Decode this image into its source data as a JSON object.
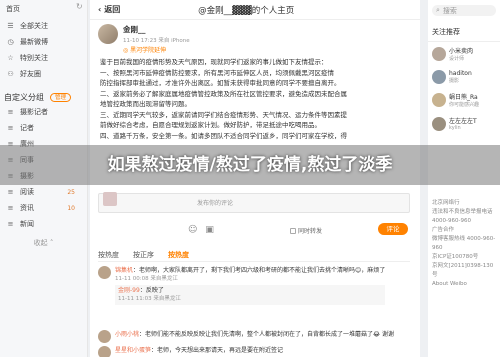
{
  "nav": {
    "home": "首页",
    "items": [
      {
        "icon": "list-icon",
        "label": "全部关注"
      },
      {
        "icon": "clock-icon",
        "label": "最新微博"
      },
      {
        "icon": "star-icon",
        "label": "特别关注"
      },
      {
        "icon": "users-icon",
        "label": "好友圈"
      }
    ],
    "group_title": "自定义分组",
    "manage": "管理",
    "groups": [
      {
        "label": "摄影记者",
        "count": ""
      },
      {
        "label": "记者",
        "count": ""
      },
      {
        "label": "廣州",
        "count": ""
      },
      {
        "label": "同事",
        "count": ""
      },
      {
        "label": "摄影",
        "count": ""
      },
      {
        "label": "阅读",
        "count": "25"
      },
      {
        "label": "资讯",
        "count": "10"
      },
      {
        "label": "新闻",
        "count": ""
      }
    ],
    "collapse": "收起"
  },
  "topbar": {
    "back": "返回",
    "title": "@金刚__▓▓▓的个人主页"
  },
  "post": {
    "author": "金刚__",
    "meta": "11-10 17:23 来自 iPhone",
    "tag": "◎ 黑河学院延伸",
    "lines": [
      "鉴于目前我国的疫情形势及天气原因，现就同学们返家的事儿做如下友情提示：",
      "一、按照黑河市延伸疫情防控要求，所有黑河市延伸区人员，均须佩戴黑河区疫情",
      "防控指挥部审批通过，才准许外出离区。如暂未获得审批同意的同学不要擅自离开。",
      "二、返家前务必了解家庭属地疫情管控政策及所在社区管控要求，避免造成因未配合属",
      "地管控政策而出现滞留等问题。",
      "三、近期同学天气较多，返家前请同学们结合疫情形势、天气情况、运力条件等因素提",
      "前做好综合考虑，自愿合理规划返家计划。做好防护，带足抵途中吃喝用品。",
      "四、道路千万条，安全第一条。如请多团队不适合同学们返乡，同学们可家在学校，得"
    ]
  },
  "banner": {
    "text": "如果熬过疫情/熬过了疫情,熬过了淡季"
  },
  "comment_box": {
    "placeholder": "发布你的评论"
  },
  "publish": {
    "also_forward": "同时转发",
    "submit": "评论"
  },
  "tabs": [
    {
      "label": "按热度",
      "active": false
    },
    {
      "label": "按正序",
      "active": false
    },
    {
      "label": "按热度",
      "active": true
    }
  ],
  "comments": [
    {
      "name": "锦集机",
      "text": "老师啊，大家队都离开了，剩下我们考四六级和考研的都不能让我们去挑个清晰吗😊，麻烦了",
      "time": "11-11 00:08 来自黑龙江",
      "reply_name": "金刚-99",
      "reply_text": "反映了",
      "reply_time": "11-11 11:03 来自黑龙江"
    },
    {
      "name": "小雨小桃",
      "text": "老师们能不能反映反映让我们先清啊，整个人都被封闭在了，自背都长成了一堆蘑菇了😂 谢谢",
      "time": "",
      "reply_name": "",
      "reply_text": "",
      "reply_time": ""
    },
    {
      "name": "星星和小蛋笋",
      "text": "老师，今天想出来那请天，再远是要在附近签记",
      "time": "",
      "reply_name": "",
      "reply_text": "",
      "reply_time": ""
    }
  ],
  "right": {
    "search_placeholder": "搜索",
    "title": "关注推荐",
    "recs": [
      {
        "name": "小米卖肉",
        "desc": "设计师"
      },
      {
        "name": "haditon",
        "desc": "摄影"
      },
      {
        "name": "蜗日熊_Ra",
        "desc": "你可能感兴趣"
      },
      {
        "name": "左左左左T",
        "desc": "kylin"
      }
    ],
    "links": [
      "北京网络行",
      "违法和不良信息举报电话 4000-960-960",
      "广告合作",
      "微博客服热线 4000-960-960",
      "京ICP证100780号",
      "京网文[2011]0398-130号",
      "About Weibo"
    ]
  }
}
